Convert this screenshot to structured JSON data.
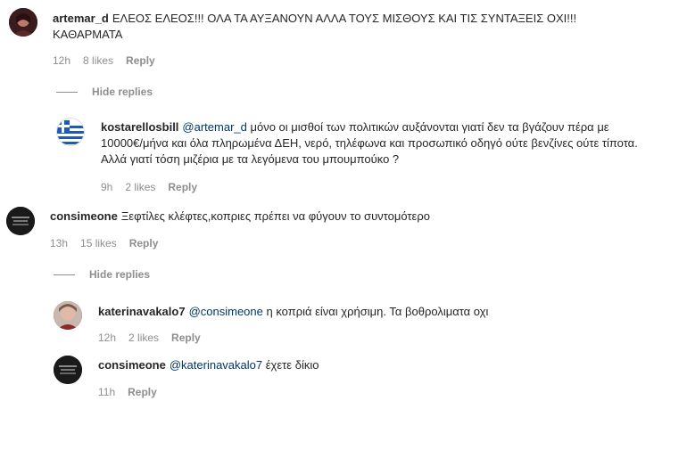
{
  "comments": [
    {
      "username": "artemar_d",
      "text": "ΕΛΕΟΣ ΕΛΕΟΣ!!! ΟΛΑ ΤΑ ΑΥΞΑΝΟΥΝ ΑΛΛΑ ΤΟΥΣ ΜΙΣΘΟΥΣ ΚΑΙ ΤΙΣ ΣΥΝΤΑΞΕΙΣ ΟΧΙ!!! ΚΑΘΑΡΜΑΤΑ",
      "time": "12h",
      "likes": "8 likes",
      "reply": "Reply",
      "hide_replies": "Hide replies",
      "replies": [
        {
          "username": "kostarellosbill",
          "mention": "@artemar_d",
          "text": "μόνο οι μισθοί των πολιτικών αυξάνονται γιατί δεν τα βγάζουν πέρα με 10000€/μήνα και όλα πληρωμένα ΔΕΗ, νερό, τηλέφωνα και προσωπικό οδηγό ούτε βενζίνες ούτε τίποτα. Αλλά γιατί τόση μιζέρια με τα λεγόμενα του μπουμπούκο ?",
          "time": "9h",
          "likes": "2 likes",
          "reply": "Reply"
        }
      ]
    },
    {
      "username": "consimeone",
      "text": "Ξεφτίλες κλέφτες,κοπριες πρέπει να φύγουν το συντομότερο",
      "time": "13h",
      "likes": "15 likes",
      "reply": "Reply",
      "hide_replies": "Hide replies",
      "replies": [
        {
          "username": "katerinavakalo7",
          "mention": "@consimeone",
          "text": "η κοπριά είναι χρήσιμη. Τα βοθρολιματα οχι",
          "time": "12h",
          "likes": "2 likes",
          "reply": "Reply"
        },
        {
          "username": "consimeone",
          "mention": "@katerinavakalo7",
          "text": "έχετε δίκιο",
          "time": "11h",
          "reply": "Reply"
        }
      ]
    }
  ]
}
